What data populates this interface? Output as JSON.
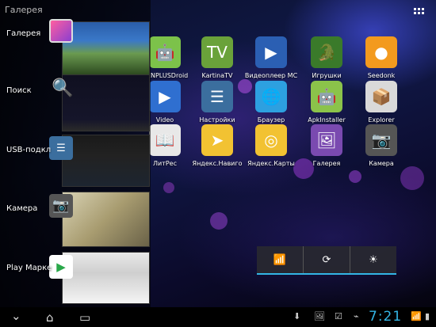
{
  "recents": [
    {
      "label": "Галерея",
      "icon": "gallery-icon"
    },
    {
      "label": "Поиск",
      "icon": "search-icon"
    },
    {
      "label": "USB-подкл",
      "icon": "usb-settings-icon"
    },
    {
      "label": "Камера",
      "icon": "camera-icon"
    },
    {
      "label": "Play Марке",
      "icon": "play-store-icon"
    }
  ],
  "recent_header": "Галерея",
  "apps": [
    {
      "label": "GENPLUSDroid",
      "icon": "android-icon",
      "color": "#7cc24a"
    },
    {
      "label": "KartinaTV",
      "icon": "tv-icon",
      "color": "#6aa23a"
    },
    {
      "label": "Видеоплеер МС",
      "icon": "play-icon",
      "color": "#2b5fb3"
    },
    {
      "label": "Игрушки",
      "icon": "game-icon",
      "color": "#3a7a2a"
    },
    {
      "label": "Seedonk",
      "icon": "seedonk-icon",
      "color": "#f39a1e"
    },
    {
      "label": "Video",
      "icon": "video-icon",
      "color": "#2f6fd0"
    },
    {
      "label": "Настройки",
      "icon": "settings-icon",
      "color": "#3b6e9e"
    },
    {
      "label": "Браузер",
      "icon": "browser-icon",
      "color": "#2da0e0"
    },
    {
      "label": "ApkInstaller",
      "icon": "apk-icon",
      "color": "#8bc34a"
    },
    {
      "label": "Explorer",
      "icon": "explorer-icon",
      "color": "#d9d9d9"
    },
    {
      "label": "ЛитРес",
      "icon": "book-icon",
      "color": "#e8e8e8"
    },
    {
      "label": "Яндекс.Навиго",
      "icon": "navigator-icon",
      "color": "#f2c232"
    },
    {
      "label": "Яндекс.Карты",
      "icon": "maps-icon",
      "color": "#f2c232"
    },
    {
      "label": "Галерея",
      "icon": "gallery-icon",
      "color": "#7a4ab0"
    },
    {
      "label": "Камера",
      "icon": "camera-icon",
      "color": "#555555"
    }
  ],
  "status": {
    "time": "7:21"
  },
  "accent": "#33b5e5"
}
